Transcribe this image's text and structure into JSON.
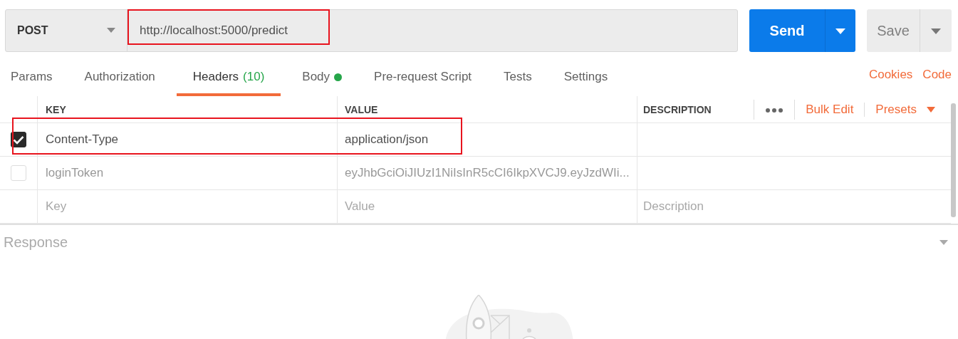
{
  "request": {
    "method": "POST",
    "url": "http://localhost:5000/predict",
    "url_highlighted": true,
    "send_label": "Send",
    "save_label": "Save"
  },
  "tabs": [
    {
      "label": "Params",
      "selected": false
    },
    {
      "label": "Authorization",
      "selected": false
    },
    {
      "label": "Headers",
      "count": "(10)",
      "selected": true
    },
    {
      "label": "Body",
      "indicator": true,
      "selected": false
    },
    {
      "label": "Pre-request Script",
      "selected": false
    },
    {
      "label": "Tests",
      "selected": false
    },
    {
      "label": "Settings",
      "selected": false
    }
  ],
  "tab_links": [
    "Cookies",
    "Code"
  ],
  "headers_table": {
    "columns": [
      "KEY",
      "VALUE",
      "DESCRIPTION"
    ],
    "bulk_edit": "Bulk Edit",
    "presets": "Presets",
    "rows": [
      {
        "checked": true,
        "highlighted": true,
        "key": "Content-Type",
        "value": "application/json"
      },
      {
        "checked": false,
        "highlighted": false,
        "key": "loginToken",
        "value": "eyJhbGciOiJIUzI1NiIsInR5cCI6IkpXVCJ9.eyJzdWIi..."
      }
    ],
    "new_row": {
      "key": {
        "placeholder": "Key"
      },
      "value": {
        "placeholder": "Value"
      },
      "description": {
        "placeholder": "Description"
      }
    }
  },
  "response": {
    "title": "Response"
  }
}
